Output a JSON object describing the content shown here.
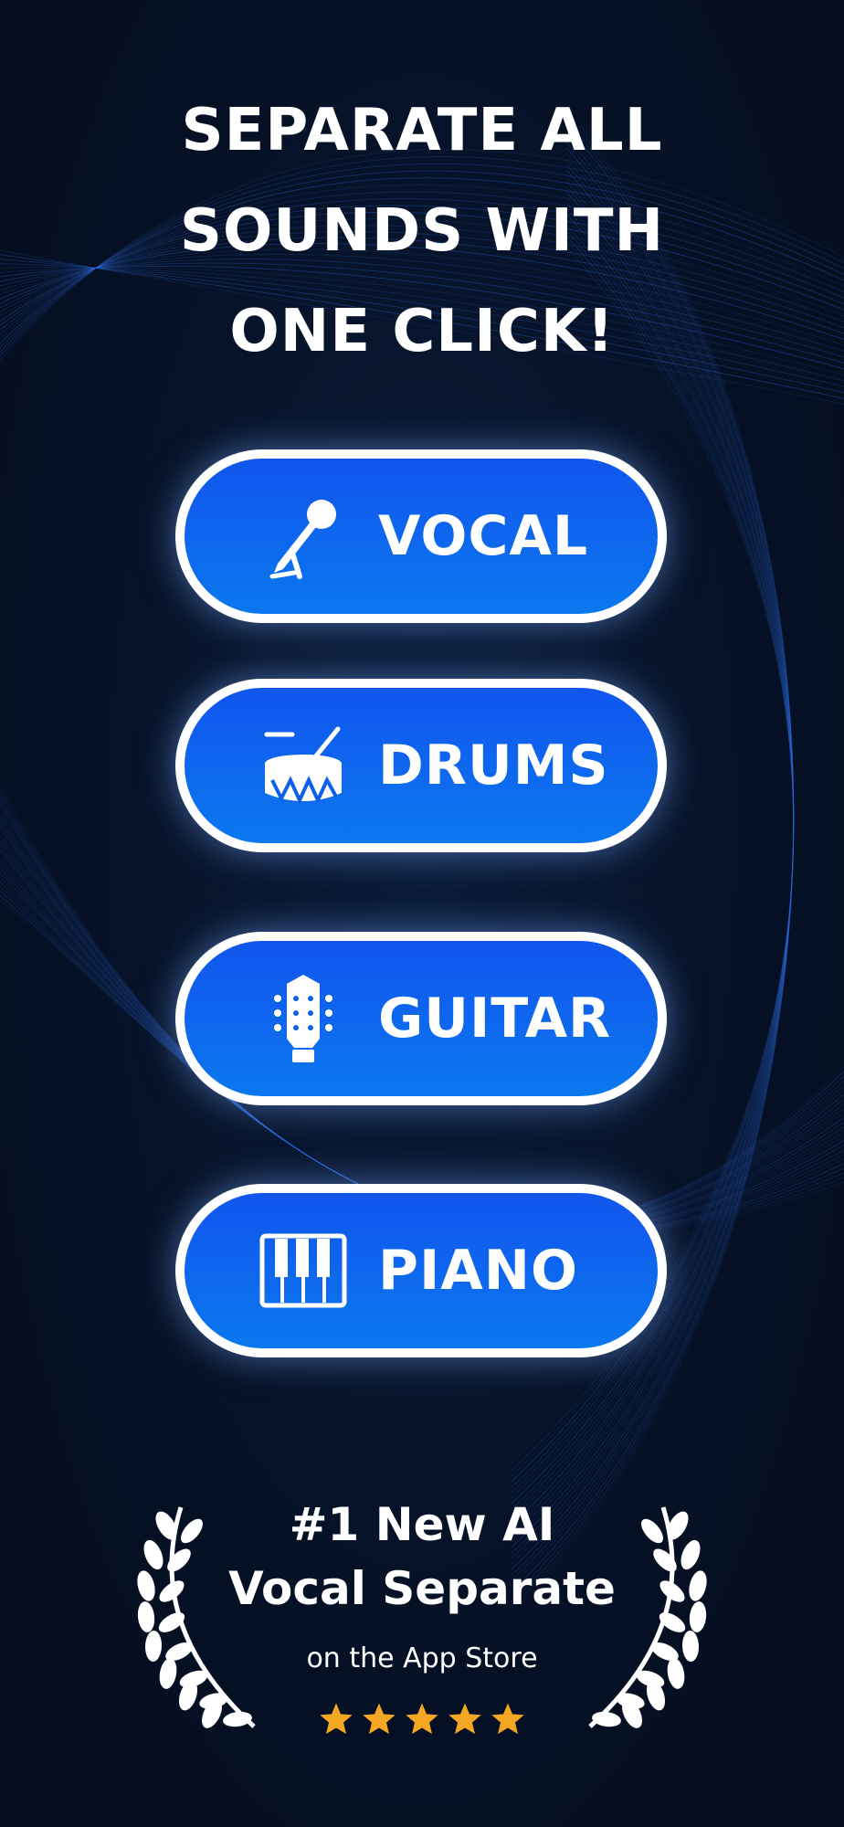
{
  "headline": [
    "SEPARATE ALL",
    "SOUNDS WITH",
    "ONE CLICK!"
  ],
  "buttons": [
    {
      "label": "VOCAL",
      "icon": "microphone-icon"
    },
    {
      "label": "DRUMS",
      "icon": "drum-icon"
    },
    {
      "label": "GUITAR",
      "icon": "guitar-headstock-icon"
    },
    {
      "label": "PIANO",
      "icon": "piano-keys-icon"
    }
  ],
  "award": {
    "line1": "#1 New AI",
    "line2": "Vocal Separate",
    "line3": "on the App Store",
    "stars": 5
  },
  "colors": {
    "background": "#061126",
    "button_gradient_top": "#1155ee",
    "button_gradient_bottom": "#0b78ee",
    "star": "#f5a623",
    "wave": "#2d6bdc"
  }
}
